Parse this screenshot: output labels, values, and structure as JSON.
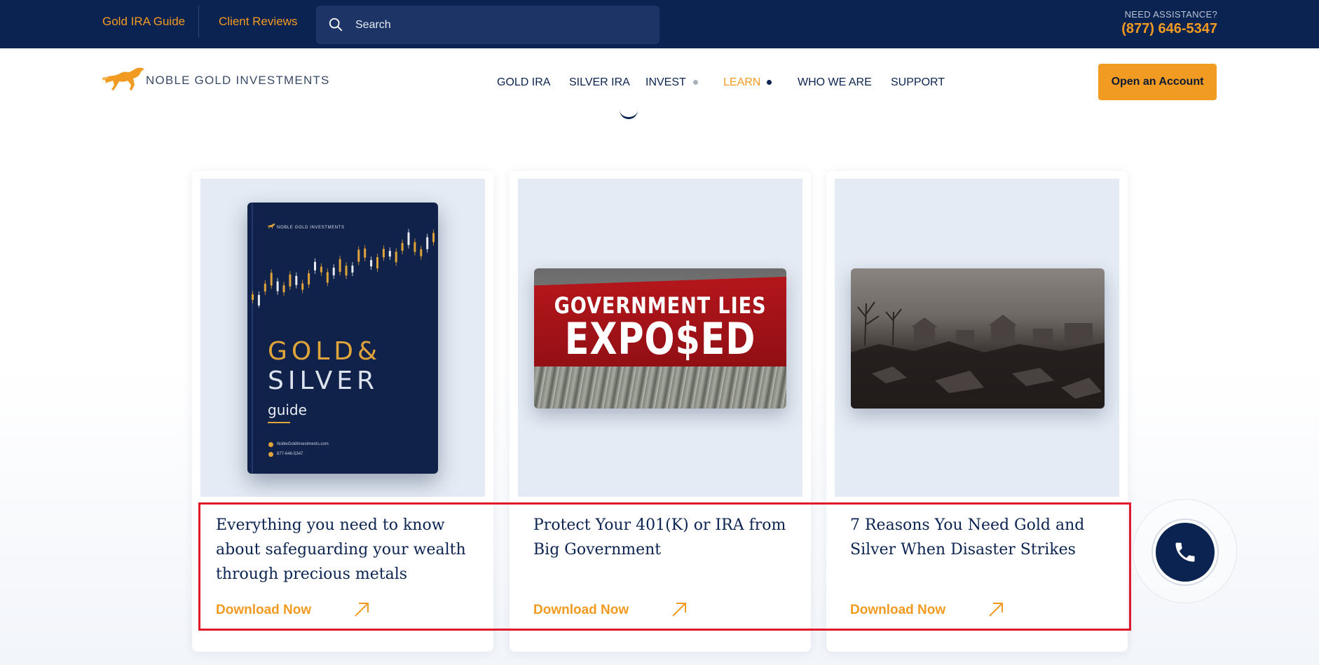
{
  "topbar": {
    "link_guide": "Gold IRA Guide",
    "link_reviews": "Client Reviews",
    "search_placeholder": "Search",
    "assist_label": "NEED ASSISTANCE?",
    "assist_phone": "(877) 646-5347"
  },
  "navbar": {
    "logo_text": "NOBLE GOLD INVESTMENTS",
    "items": [
      {
        "label": "GOLD IRA"
      },
      {
        "label": "SILVER IRA"
      },
      {
        "label": "INVEST"
      },
      {
        "label": "LEARN"
      },
      {
        "label": "WHO WE ARE"
      },
      {
        "label": "SUPPORT"
      }
    ],
    "cta": "Open an Account"
  },
  "cards": [
    {
      "title": "Everything you need to know about safeguarding your wealth through precious metals",
      "link": "Download Now",
      "cover": {
        "brand": "NOBLE GOLD INVESTMENTS",
        "title_gold": "GOLD&",
        "title_silver": "SILVER",
        "subtitle": "guide",
        "website": "NobleGoldInvestments.com",
        "phone": "877-646-5347"
      }
    },
    {
      "title": "Protect Your 401(K) or IRA from Big Government",
      "link": "Download Now",
      "image_text_1": "GOVERNMENT LIES",
      "image_text_2": "EXPO$ED"
    },
    {
      "title": "7 Reasons You Need Gold and Silver When Disaster Strikes",
      "link": "Download Now"
    }
  ],
  "colors": {
    "navy": "#0b2350",
    "gold": "#f29b22",
    "highlight": "#e0192c"
  },
  "icons": {
    "search": "search-icon",
    "logo": "horse-icon",
    "arrow": "arrow-up-right-icon",
    "phone": "phone-icon"
  }
}
